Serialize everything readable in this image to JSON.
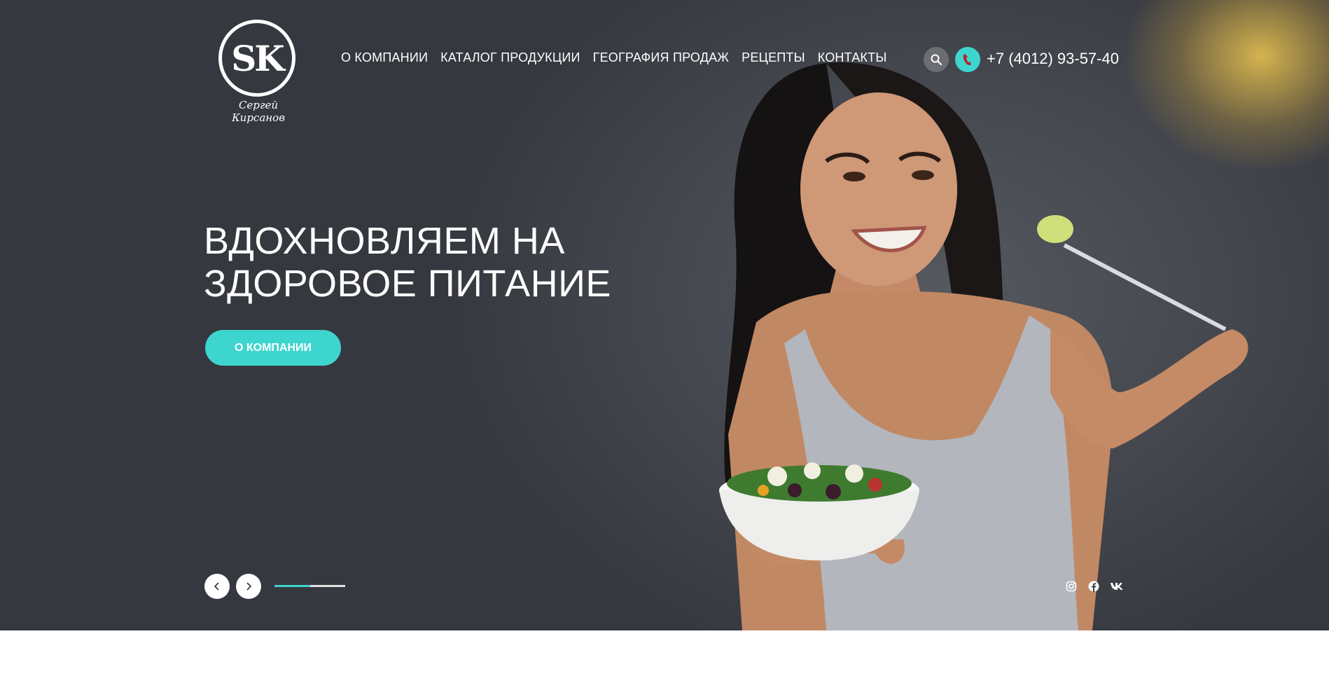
{
  "brand": {
    "logo_mark": "SK",
    "signature": "Сергей Кирсанов"
  },
  "nav": {
    "items": [
      {
        "label": "О КОМПАНИИ"
      },
      {
        "label": "КАТАЛОГ ПРОДУКЦИИ"
      },
      {
        "label": "ГЕОГРАФИЯ ПРОДАЖ"
      },
      {
        "label": "РЕЦЕПТЫ"
      },
      {
        "label": "КОНТАКТЫ"
      }
    ]
  },
  "header": {
    "search_icon": "search-icon",
    "phone_icon": "phone-icon",
    "phone": "+7 (4012) 93-57-40"
  },
  "hero": {
    "headline_line1": "ВДОХНОВЛЯЕМ НА",
    "headline_line2": "ЗДОРОВОЕ ПИТАНИЕ",
    "cta_label": "О КОМПАНИИ"
  },
  "slider": {
    "prev_icon": "chevron-left-icon",
    "next_icon": "chevron-right-icon",
    "progress_fraction": 0.5
  },
  "social": [
    "instagram-icon",
    "facebook-icon",
    "vk-icon"
  ],
  "colors": {
    "accent": "#3fd5cf",
    "hero_bg": "#3a3d44",
    "text": "#ffffff"
  }
}
